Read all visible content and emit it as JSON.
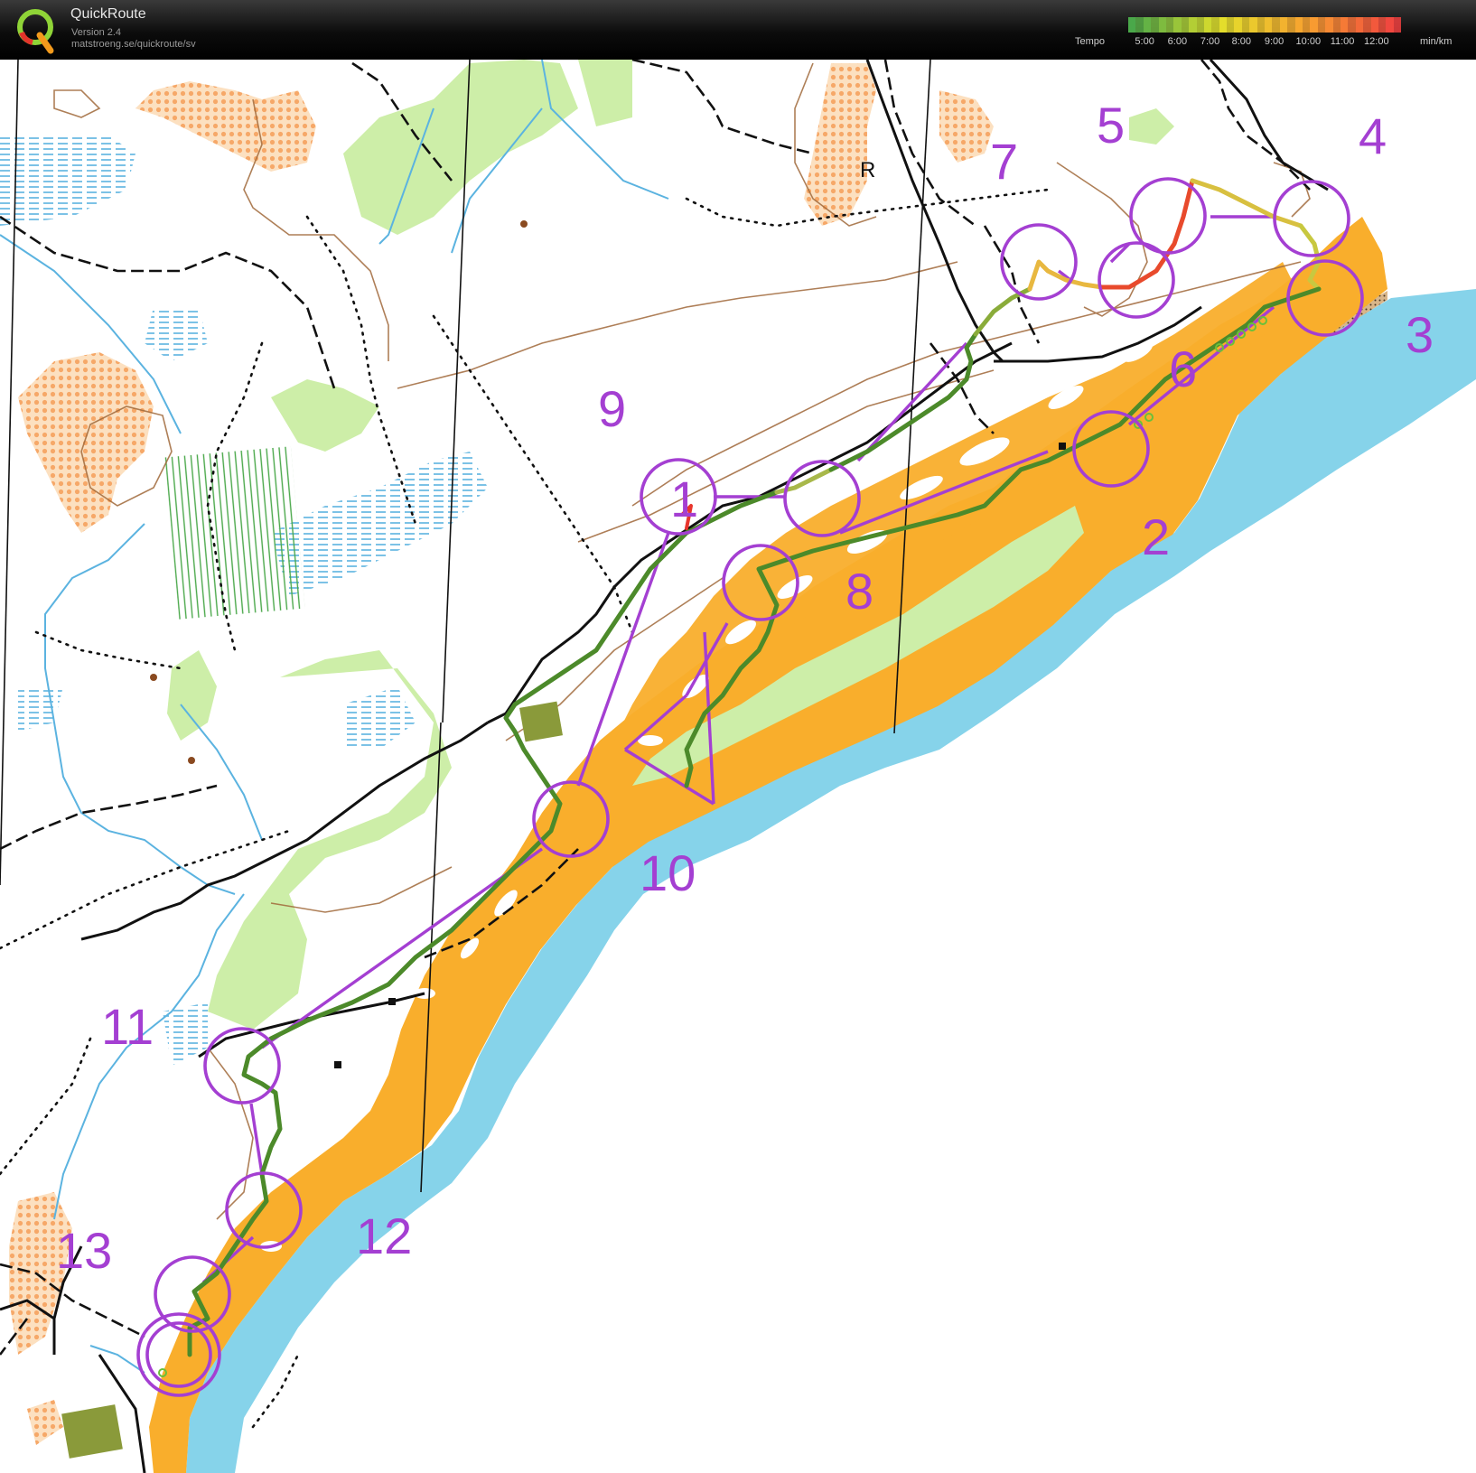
{
  "header": {
    "app_name": "QuickRoute",
    "version": "Version 2.4",
    "url": "matstroeng.se/quickroute/sv",
    "tempo_label": "Tempo",
    "tempo_unit": "min/km",
    "tempo_ticks": [
      "5:00",
      "6:00",
      "7:00",
      "8:00",
      "9:00",
      "10:00",
      "11:00",
      "12:00"
    ],
    "tempo_colors": [
      "#4aa84a",
      "#e3e02b",
      "#f8a030",
      "#f04040"
    ],
    "logo_letter": "Q"
  },
  "map": {
    "legend_colors": {
      "water": "#86d3ea",
      "open_land": "#f9ae2c",
      "rough_open": "#fccf86",
      "green_vegetation": "#cdeea8",
      "course": "#a43fd2",
      "route_fast": "#4c8a2a",
      "route_slow": "#e8352c"
    },
    "controls": [
      {
        "number": "1"
      },
      {
        "number": "2"
      },
      {
        "number": "3"
      },
      {
        "number": "4"
      },
      {
        "number": "5"
      },
      {
        "number": "6"
      },
      {
        "number": "7"
      },
      {
        "number": "8"
      },
      {
        "number": "9"
      },
      {
        "number": "10"
      },
      {
        "number": "11"
      },
      {
        "number": "12"
      },
      {
        "number": "13"
      }
    ],
    "map_text": "R"
  }
}
